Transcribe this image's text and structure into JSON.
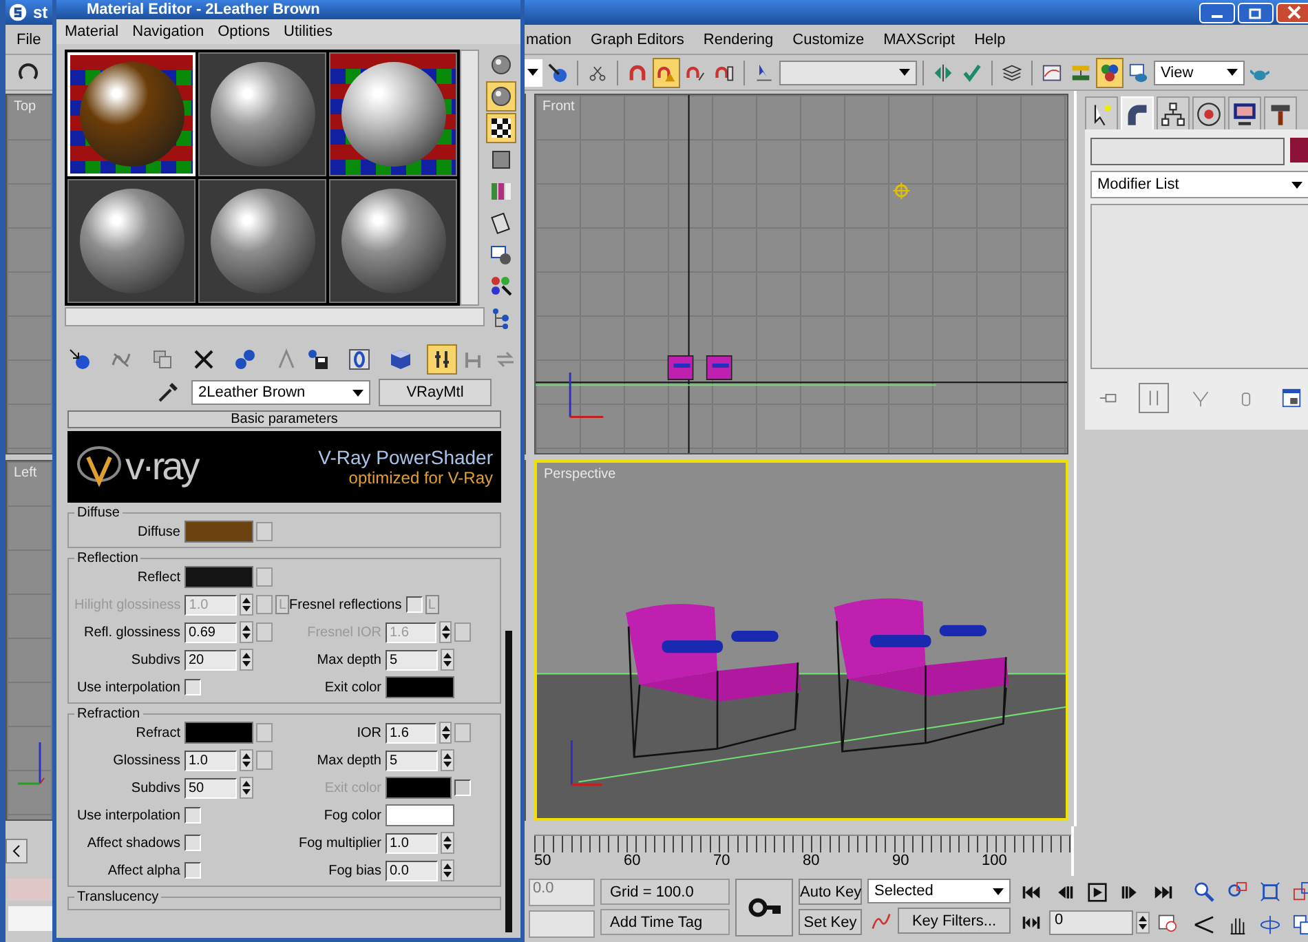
{
  "app_title": "st",
  "menu_left": [
    "File"
  ],
  "menu": [
    "mation",
    "Graph Editors",
    "Rendering",
    "Customize",
    "MAXScript",
    "Help"
  ],
  "toolbar": {
    "left_buttons": [
      {
        "selected": false
      },
      {
        "selected": false
      },
      {
        "selected": false
      },
      {
        "selected": true
      },
      {
        "selected": false
      },
      {
        "selected": false
      },
      {
        "selected": false
      }
    ],
    "right_buttons": [
      {
        "selected": false
      },
      {
        "selected": false
      },
      {
        "selected": false
      },
      {
        "selected": false
      },
      {
        "selected": false
      },
      {
        "selected": true
      },
      {
        "selected": false
      }
    ],
    "render_dropdown": "View"
  },
  "viewports": [
    {
      "label": "Top",
      "active": false
    },
    {
      "label": "Left",
      "active": false
    },
    {
      "label": "Front",
      "active": false
    },
    {
      "label": "Perspective",
      "active": true
    }
  ],
  "command_panel": {
    "tabs": [
      {
        "selected": false
      },
      {
        "selected": true
      },
      {
        "selected": false
      },
      {
        "selected": false
      },
      {
        "selected": false
      },
      {
        "selected": false
      }
    ],
    "object_swatch": {
      "color": "#8c1238"
    },
    "modifier_list": "Modifier List",
    "stack_buttons": [
      {
        "selected": false
      },
      {
        "selected": true
      },
      {
        "selected": false
      },
      {
        "selected": false
      },
      {
        "selected": false
      }
    ]
  },
  "timeline": {
    "ticks": [
      "50",
      "60",
      "70",
      "80",
      "90",
      "100"
    ]
  },
  "status": {
    "coord_value": "0.0",
    "grid": "Grid = 100.0",
    "time_tag": "Add Time Tag",
    "auto_key": "Auto Key",
    "auto_key_on": false,
    "set_key": "Set Key",
    "key_mode": "Selected",
    "key_filters": "Key Filters...",
    "frame": "0"
  },
  "material_editor": {
    "title": "Material Editor - 2Leather Brown",
    "menu": [
      "Material",
      "Navigation",
      "Options",
      "Utilities"
    ],
    "slots": [
      {
        "selected": true,
        "checker": true,
        "color": "#6a3c08"
      },
      {
        "selected": false,
        "checker": false,
        "color": "#9a9a9a"
      },
      {
        "selected": false,
        "checker": true,
        "color": "#c0c0c0"
      },
      {
        "selected": false,
        "checker": false,
        "color": "#8e8e8e"
      },
      {
        "selected": false,
        "checker": false,
        "color": "#8e8e8e"
      },
      {
        "selected": false,
        "checker": false,
        "color": "#8e8e8e"
      }
    ],
    "side_buttons": [
      {
        "selected": false
      },
      {
        "selected": true
      },
      {
        "selected": true
      },
      {
        "selected": false
      },
      {
        "selected": false
      },
      {
        "selected": false
      },
      {
        "selected": false
      },
      {
        "selected": false
      },
      {
        "selected": false
      }
    ],
    "toolbar_buttons": [
      {
        "selected": false
      },
      {
        "selected": false
      },
      {
        "selected": false
      },
      {
        "selected": false
      },
      {
        "selected": false
      },
      {
        "selected": false
      },
      {
        "selected": false
      },
      {
        "selected": false
      },
      {
        "selected": false
      },
      {
        "selected": true
      },
      {
        "selected": false
      },
      {
        "selected": false
      }
    ],
    "material_name": "2Leather Brown",
    "material_type": "VRayMtl",
    "rollout": "Basic parameters",
    "banner": {
      "logo": "v·ray",
      "title": "V-Ray PowerShader",
      "subtitle": "optimized for V-Ray"
    },
    "groups": [
      {
        "title": "Diffuse",
        "rows": [
          {
            "left": {
              "kind": "color",
              "label": "Diffuse",
              "color": "#6b4210",
              "map": true,
              "disabled": false
            }
          }
        ]
      },
      {
        "title": "Reflection",
        "rows": [
          {
            "left": {
              "kind": "color",
              "label": "Reflect",
              "color": "#141414",
              "map": true,
              "disabled": false
            }
          },
          {
            "left": {
              "kind": "spinner",
              "label": "Hilight glossiness",
              "value": "1.0",
              "map": true,
              "lock": "L",
              "disabled": true
            },
            "right": {
              "kind": "checkbox",
              "label": "Fresnel reflections",
              "checked": false,
              "lock": "L",
              "disabled": false
            }
          },
          {
            "left": {
              "kind": "spinner",
              "label": "Refl. glossiness",
              "value": "0.69",
              "map": true,
              "disabled": false
            },
            "right": {
              "kind": "spinner",
              "label": "Fresnel IOR",
              "value": "1.6",
              "map": true,
              "disabled": true
            }
          },
          {
            "left": {
              "kind": "spinner",
              "label": "Subdivs",
              "value": "20",
              "map": false,
              "disabled": false
            },
            "right": {
              "kind": "spinner",
              "label": "Max depth",
              "value": "5",
              "map": false,
              "disabled": false
            }
          },
          {
            "left": {
              "kind": "checkbox",
              "label": "Use interpolation",
              "checked": false,
              "disabled": false
            },
            "right": {
              "kind": "color",
              "label": "Exit color",
              "color": "#000000",
              "map": false,
              "disabled": false
            }
          }
        ]
      },
      {
        "title": "Refraction",
        "rows": [
          {
            "left": {
              "kind": "color",
              "label": "Refract",
              "color": "#000000",
              "map": true,
              "disabled": false
            },
            "right": {
              "kind": "spinner",
              "label": "IOR",
              "value": "1.6",
              "map": true,
              "disabled": false
            }
          },
          {
            "left": {
              "kind": "spinner",
              "label": "Glossiness",
              "value": "1.0",
              "map": true,
              "disabled": false
            },
            "right": {
              "kind": "spinner",
              "label": "Max depth",
              "value": "5",
              "map": false,
              "disabled": false
            }
          },
          {
            "left": {
              "kind": "spinner",
              "label": "Subdivs",
              "value": "50",
              "map": false,
              "disabled": false
            },
            "right": {
              "kind": "color",
              "label": "Exit color",
              "color": "#000000",
              "map": false,
              "toggle": false,
              "disabled": true
            }
          },
          {
            "left": {
              "kind": "checkbox",
              "label": "Use interpolation",
              "checked": false,
              "disabled": false
            },
            "right": {
              "kind": "color",
              "label": "Fog color",
              "color": "#ffffff",
              "map": false,
              "disabled": false
            }
          },
          {
            "left": {
              "kind": "checkbox",
              "label": "Affect shadows",
              "checked": false,
              "disabled": false
            },
            "right": {
              "kind": "spinner",
              "label": "Fog multiplier",
              "value": "1.0",
              "map": false,
              "disabled": false
            }
          },
          {
            "left": {
              "kind": "checkbox",
              "label": "Affect alpha",
              "checked": false,
              "disabled": false
            },
            "right": {
              "kind": "spinner",
              "label": "Fog bias",
              "value": "0.0",
              "map": false,
              "disabled": false
            }
          }
        ]
      },
      {
        "title": "Translucency"
      }
    ]
  }
}
